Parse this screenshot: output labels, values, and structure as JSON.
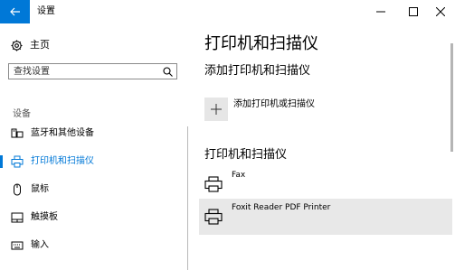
{
  "window": {
    "title": "设置"
  },
  "sidebar": {
    "home_label": "主页",
    "search_placeholder": "查找设置",
    "section_label": "设备",
    "items": [
      {
        "label": "蓝牙和其他设备",
        "icon": "bluetooth-devices-icon",
        "active": false
      },
      {
        "label": "打印机和扫描仪",
        "icon": "printer-icon",
        "active": true
      },
      {
        "label": "鼠标",
        "icon": "mouse-icon",
        "active": false
      },
      {
        "label": "触摸板",
        "icon": "touchpad-icon",
        "active": false
      },
      {
        "label": "输入",
        "icon": "keyboard-icon",
        "active": false
      }
    ]
  },
  "main": {
    "title": "打印机和扫描仪",
    "add_section_title": "添加打印机和扫描仪",
    "add_button_label": "添加打印机或扫描仪",
    "list_title": "打印机和扫描仪",
    "printers": [
      {
        "name": "Fax",
        "highlighted": false
      },
      {
        "name": "Foxit Reader PDF Printer",
        "highlighted": true
      }
    ]
  },
  "colors": {
    "accent": "#0078d7",
    "highlight": "#e8e8e8",
    "add_button_bg": "#e6e6e6"
  }
}
